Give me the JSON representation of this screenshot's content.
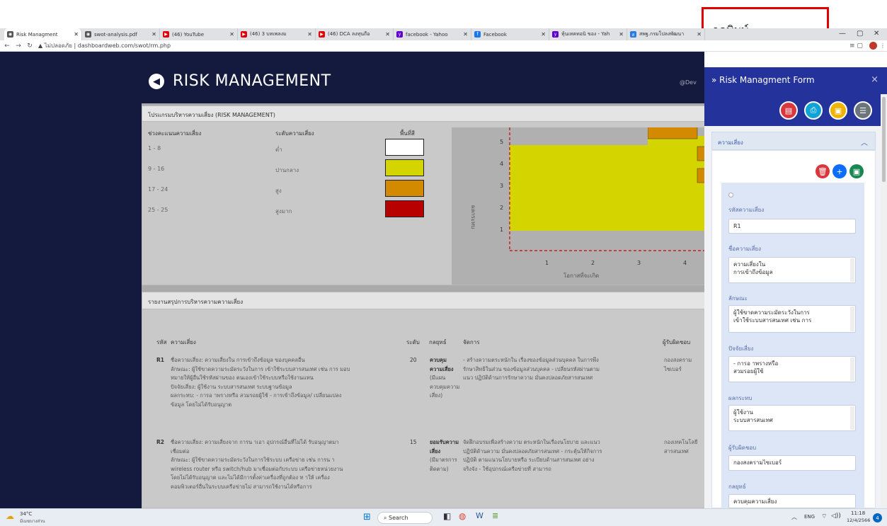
{
  "browser": {
    "tabs": [
      {
        "title": "Risk Managment",
        "color": "#555555",
        "glyph": "◉"
      },
      {
        "title": "swot-analysis.pdf",
        "color": "#555555",
        "glyph": "◉"
      },
      {
        "title": "(46) YouTube",
        "color": "#e00000",
        "glyph": "▶"
      },
      {
        "title": "(46) 3 บทเพลงม",
        "color": "#e00000",
        "glyph": "▶"
      },
      {
        "title": "(46) DCA ลงทุนถือ",
        "color": "#e00000",
        "glyph": "▶"
      },
      {
        "title": "facebook - Yahoo",
        "color": "#6001d2",
        "glyph": "y"
      },
      {
        "title": "Facebook",
        "color": "#1877f2",
        "glyph": "f"
      },
      {
        "title": "หุ้นเทคทอนิ ของ - Yah",
        "color": "#6001d2",
        "glyph": "y"
      },
      {
        "title": "สพฐ.กรมโปลงพัฒนา",
        "color": "#2a7ae2",
        "glyph": "ส"
      }
    ],
    "address_security": "ไม่ปลอดภัย",
    "address_url": "dashboardweb.com/swot/rm.php"
  },
  "app": {
    "title": "RISK MANAGEMENT",
    "user": "@Dev"
  },
  "panel1": {
    "title": "โปรแกรมบริหารความเสี่ยง (RISK MANAGEMENT)",
    "col_range": "ช่วงคะแนนความเสี่ยง",
    "col_level": "ระดับความเสี่ยง",
    "col_area": "พื้นที่สี",
    "rows": [
      {
        "range": "1 - 8",
        "level": "ต่ำ",
        "color": "#ffffff"
      },
      {
        "range": "9 - 16",
        "level": "ปานกลาง",
        "color": "#d4d400"
      },
      {
        "range": "17 - 24",
        "level": "สูง",
        "color": "#d48a00"
      },
      {
        "range": "25 - 25",
        "level": "สูงมาก",
        "color": "#b80000"
      }
    ]
  },
  "chart_data": {
    "type": "heatmap",
    "x_ticks": [
      "1",
      "2",
      "3",
      "4"
    ],
    "y_ticks": [
      "1",
      "2",
      "3",
      "4",
      "5"
    ],
    "ylabel": "ผลกระทบ",
    "xlabel": "โอกาสที่จะเกิด",
    "threshold_lines": "red dashed at x=1 and y=1"
  },
  "panel2": {
    "title": "รายงานสรุปการบริหารความความเสี่ยง",
    "headers": {
      "id": "รหัส",
      "risk": "ความเสี่ยง",
      "level": "ระดับ",
      "strategy": "กลยุทธ์",
      "manage": "จัดการ",
      "owner": "ผู้รับผิดชอบ"
    },
    "rows": [
      {
        "id": "R1",
        "lines": [
          "ชื่อความเสี่ยง: ความเสี่ยงใน การเข้าถึงข้อมูล ของบุคคลอื่น",
          "ลักษณะ: ผู้ใช้ขาดความระมัดระวังในการ เข้าใช้ระบบสารสนเทศ เช่น การ มอบ",
          "หมายให้ผู้อื่นใช้รหัสผ่านของ ตนเองเข้าใช้ระบบหรือใช้งานแทน",
          "ปัจจัยเสี่ยง: ผู้ใช้งาน ระบบสารสนเทศ ระบบฐานข้อมูล",
          "ผลกระทบ: - การอ าพรางหรือ สวมรอยผู้ใช้ - การเข้าถึงข้อมูล/ เปลี่ยนแปลง",
          "ข้อมูล โดยไม่ได้รับอนุญาต"
        ],
        "level": "20",
        "strategy": [
          "ควบคุม",
          "ความเสี่ยง",
          "(มีแผน",
          "ควบคุมความ",
          "เสี่ยง)"
        ],
        "manage": [
          "- สร้างความตระหนักใน เรื่องของข้อมูลส่วนบุคคล ในการพึง",
          "รักษาสิทธิในส่วน ของข้อมูลส่วนบุคคล - เปลี่ยนรหัสผ่านตาม",
          "แนว ปฏิบัติด้านการรักษาความ มั่นคงปลอดภัยสารสนเทศ"
        ],
        "owner": [
          "กองสงคราม",
          "ไซเบอร์"
        ]
      },
      {
        "id": "R2",
        "lines": [
          "ชื่อความเสี่ยง: ความเสี่ยงจาก การน าเอา อุปกรณ์อื่นที่ไม่ได้ รับอนุญาตมา",
          "เชื่อมต่อ",
          "ลักษณะ: ผู้ใช้ขาดความระมัดระวังในการใช้ระบบ เครือข่าย เช่น การน า",
          "wireless router หรือ switch/hub มาเชื่อมต่อกับระบบ เครือข่ายหน่วยงาน",
          "โดยไม่ได้รับอนุญาต และไม่ได้มีการตั้งค่าเครื่องที่ถูกต้อง ท าให้ เครื่อง",
          "คอมพิวเตอร์อื่นในระบบเครือข่ายไม่ สามารถใช้งานได้หรือการ"
        ],
        "level": "15",
        "strategy": [
          "ยอมรับความ",
          "เสี่ยง",
          "(มีมาตรการ",
          "ติดตาม)"
        ],
        "manage": [
          "จัดฝึกอบรมเพื่อสร้างความ ตระหนักในเรื่องนโยบาย และแนว",
          "ปฏิบัติด้านความ มั่นคงปลอดภัยสารสนเทศ - กระตุ้นให้กิจการ",
          "ปฏิบัติ ตามแนวนโยบายหรือ ระเบียบด้านสารสนเทศ อย่าง",
          "จริงจัง - ใช้อุปกรณ์เครือข่ายที่ สามารถ"
        ],
        "owner": [
          "กองเทคโนโลยี",
          "สารสนเทศ"
        ]
      }
    ]
  },
  "side": {
    "title": "» Risk Managment Form",
    "close": "×",
    "section": "ความเสี่ยง",
    "fields": {
      "code_label": "รหัสความเสี่ยง",
      "code_value": "R1",
      "name_label": "ชื่อความเสี่ยง",
      "name_value": "ความเสี่ยงใน\nการเข้าถึงข้อมูล",
      "nature_label": "ลักษณะ",
      "nature_value": "ผู้ใช้ขาดความระมัดระวังในการ\nเข้าใช้ระบบสารสนเทศ เช่น การ",
      "factor_label": "ปัจจัยเสี่ยง",
      "factor_value": "- การอ าพรางหรือ\nสวมรอยผู้ใช้",
      "impact_label": "ผลกระทบ",
      "impact_value": "ผู้ใช้งาน\nระบบสารสนเทศ",
      "owner_label": "ผู้รับผิดชอบ",
      "owner_value": "กองสงครามไซเบอร์",
      "strategy_label": "กลยุทธ์",
      "strategy_value": "ควบคุมความเสี่ยง"
    }
  },
  "callout": {
    "text": "กดพิมพ์"
  },
  "taskbar": {
    "weather_temp": "34°C",
    "weather_desc": "มีเมฆบางส่วน",
    "search": "Search",
    "lang": "ENG",
    "time": "11:18",
    "date": "12/4/2566",
    "notif": "4"
  }
}
